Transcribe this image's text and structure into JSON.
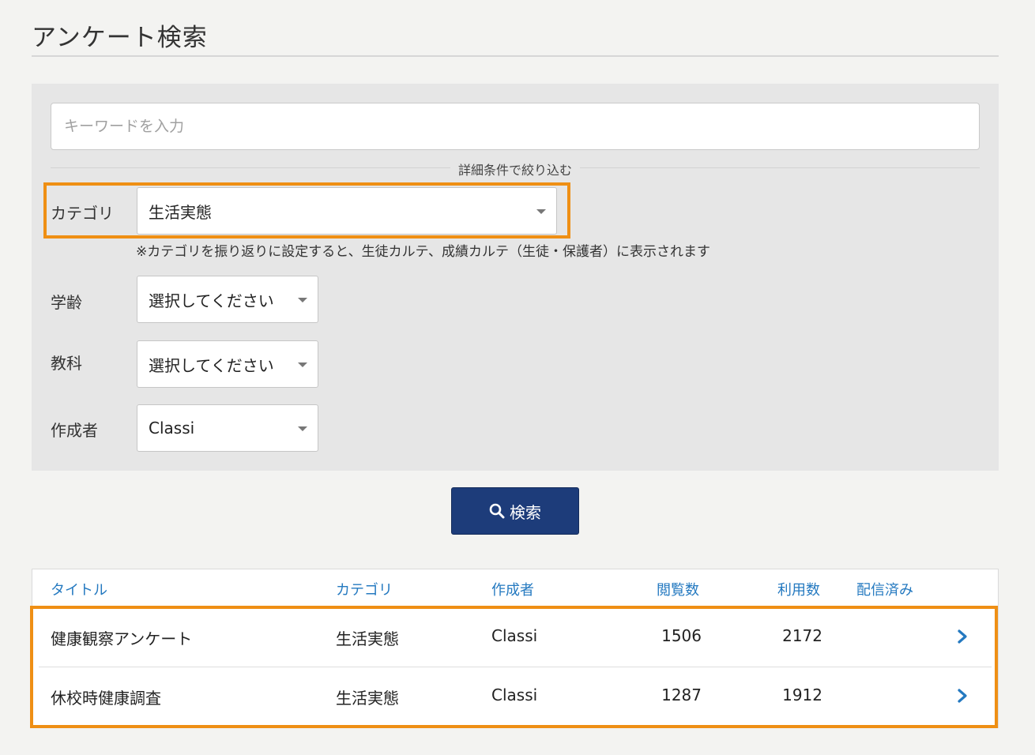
{
  "page": {
    "title": "アンケート検索"
  },
  "search": {
    "keyword_placeholder": "キーワードを入力",
    "filter_divider": "詳細条件で絞り込む",
    "category": {
      "label": "カテゴリ",
      "value": "生活実態"
    },
    "category_hint": "※カテゴリを振り返りに設定すると、生徒カルテ、成績カルテ（生徒・保護者）に表示されます",
    "grade": {
      "label": "学齢",
      "value": "選択してください"
    },
    "subject": {
      "label": "教科",
      "value": "選択してください"
    },
    "author": {
      "label": "作成者",
      "value": "Classi"
    },
    "button_label": "検索"
  },
  "results": {
    "columns": [
      "タイトル",
      "カテゴリ",
      "作成者",
      "閲覧数",
      "利用数",
      "配信済み"
    ],
    "rows": [
      {
        "title": "健康観察アンケート",
        "category": "生活実態",
        "author": "Classi",
        "views": "1506",
        "uses": "2172",
        "delivered": ""
      },
      {
        "title": "休校時健康調査",
        "category": "生活実態",
        "author": "Classi",
        "views": "1287",
        "uses": "1912",
        "delivered": ""
      }
    ]
  },
  "colors": {
    "accent_highlight": "#ef8f14",
    "button_primary": "#1d3c7a",
    "link_blue": "#2479c0"
  },
  "icons": {
    "search_button_icon": "search-icon",
    "row_chevron_icon": "chevron-right-icon",
    "select_caret_icon": "caret-down-icon"
  }
}
